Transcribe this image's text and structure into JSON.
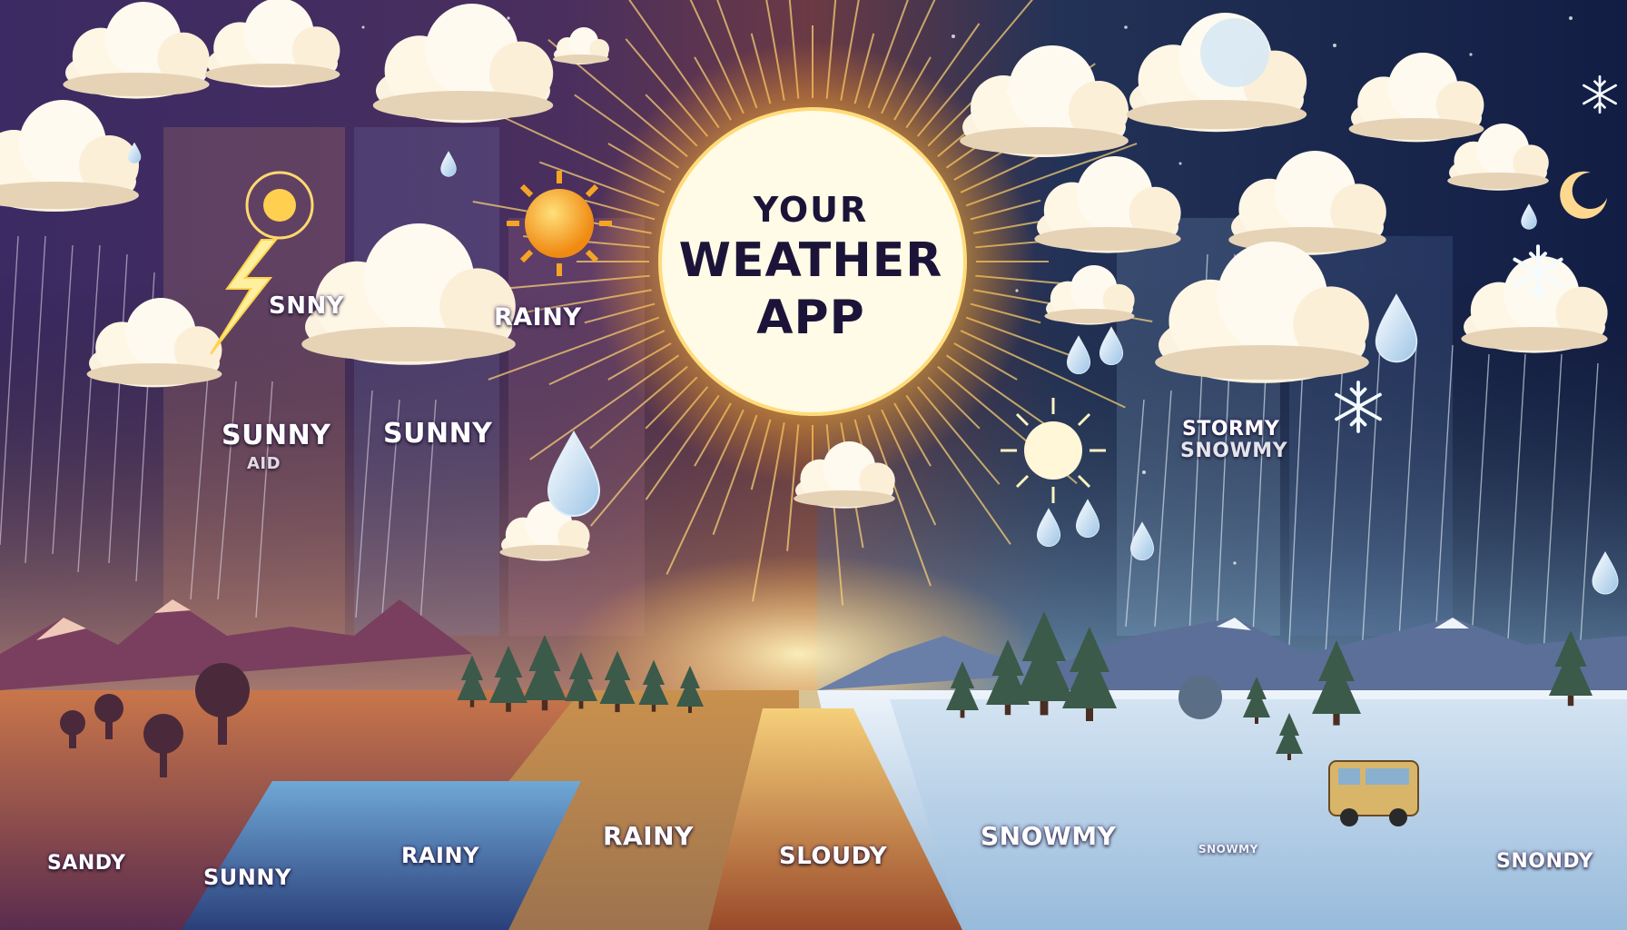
{
  "title": {
    "line1": "YOUR",
    "line2": "WEATHER",
    "line3": "APP"
  },
  "labels": {
    "sunny_top_left": "SNNY",
    "rainy_top": "RAINY",
    "sunny_mid_left": "SUNNY",
    "sunny_mid_left_sub": "AID",
    "sunny_mid": "SUNNY",
    "stormy": "STORMY",
    "snowmy_top": "SNOWMY",
    "sandy": "SANDY",
    "sunny_bottom": "SUNNY",
    "rainy_bottom_left": "RAINY",
    "rainy_bottom": "RAINY",
    "cloudy_bottom": "SLOUDY",
    "snowmy_bottom": "SNOWMY",
    "snowmy_small": "SNOWMY",
    "windy_bottom": "SNONDY"
  },
  "colors": {
    "sky_left": "#3a2360",
    "sky_right": "#15224a",
    "sun_core": "#fffbe6",
    "sun_glow": "#ffb62e",
    "ground_left": "#b4603c",
    "ground_right": "#dde8f2",
    "title_text": "#1c1438"
  },
  "icons": [
    "sun-icon",
    "lightning-icon",
    "cloud-icon",
    "raindrop-icon",
    "snowflake-icon",
    "moon-icon",
    "mountain-icon",
    "tree-icon",
    "van-icon"
  ]
}
